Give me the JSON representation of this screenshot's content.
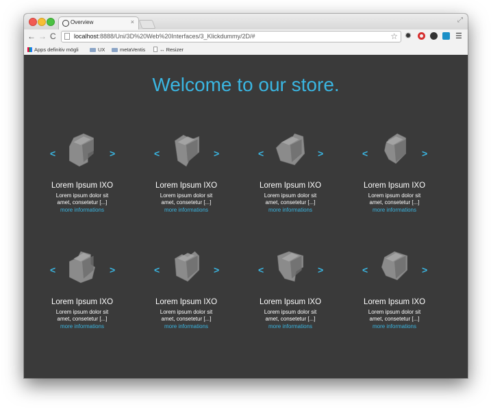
{
  "browser": {
    "tab_title": "Overview",
    "tab_close": "×",
    "url_host": "localhost",
    "url_path": ":8888/Uni/3D%20Web%20Interfaces/3_Klickdummy/2D/#",
    "bookmarks": [
      {
        "label": "Apps definitiv mögli",
        "icon": "grid-icon"
      },
      {
        "label": "UX",
        "icon": "folder-icon"
      },
      {
        "label": "metaVentis",
        "icon": "folder-icon"
      },
      {
        "label": "↔ Resizer",
        "icon": "doc-icon"
      }
    ]
  },
  "page": {
    "heading": "Welcome to our store.",
    "accent_color": "#3ab6e2",
    "background_color": "#3a3a3a",
    "prev_arrow": "<",
    "next_arrow": ">",
    "products": [
      {
        "title": "Lorem Ipsum IXO",
        "desc_line1": "Lorem ipsum dolor sit",
        "desc_line2": "amet, consetetur [...]",
        "link": "more informations"
      },
      {
        "title": "Lorem Ipsum IXO",
        "desc_line1": "Lorem ipsum dolor sit",
        "desc_line2": "amet, consetetur [...]",
        "link": "more informations"
      },
      {
        "title": "Lorem Ipsum IXO",
        "desc_line1": "Lorem ipsum dolor sit",
        "desc_line2": "amet, consetetur [...]",
        "link": "more informations"
      },
      {
        "title": "Lorem Ipsum IXO",
        "desc_line1": "Lorem ipsum dolor sit",
        "desc_line2": "amet, consetetur [...]",
        "link": "more informations"
      },
      {
        "title": "Lorem Ipsum IXO",
        "desc_line1": "Lorem ipsum dolor sit",
        "desc_line2": "amet, consetetur [...]",
        "link": "more informations"
      },
      {
        "title": "Lorem Ipsum IXO",
        "desc_line1": "Lorem ipsum dolor sit",
        "desc_line2": "amet, consetetur [...]",
        "link": "more informations"
      },
      {
        "title": "Lorem Ipsum IXO",
        "desc_line1": "Lorem ipsum dolor sit",
        "desc_line2": "amet, consetetur [...]",
        "link": "more informations"
      },
      {
        "title": "Lorem Ipsum IXO",
        "desc_line1": "Lorem ipsum dolor sit",
        "desc_line2": "amet, consetetur [...]",
        "link": "more informations"
      }
    ]
  }
}
